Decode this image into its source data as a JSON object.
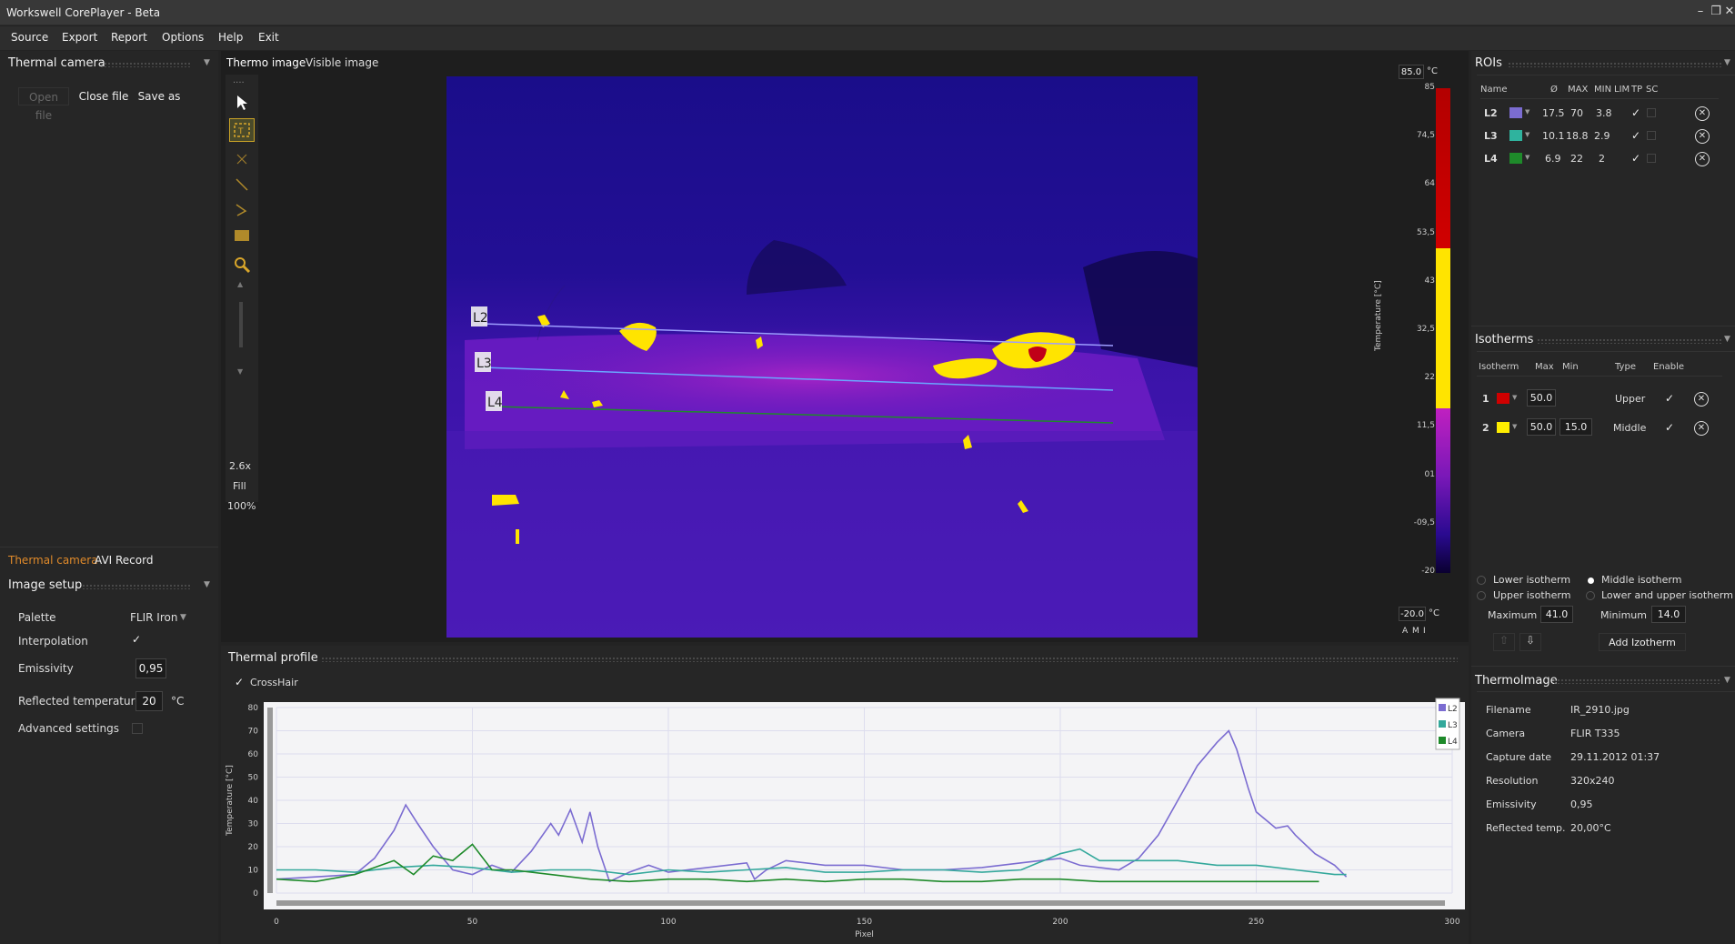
{
  "app": {
    "title": "Workswell CorePlayer - Beta"
  },
  "menu": [
    "Source",
    "Export",
    "Report",
    "Options",
    "Help",
    "Exit"
  ],
  "left": {
    "camera_title": "Thermal camera",
    "open_file": "Open file",
    "close_file": "Close file",
    "save_as": "Save as",
    "tabs": {
      "active": "Thermal camera",
      "other": "AVI Record"
    },
    "image_setup": {
      "title": "Image setup",
      "palette_label": "Palette",
      "palette_value": "FLIR Iron",
      "interpolation_label": "Interpolation",
      "interpolation_checked": true,
      "emissivity_label": "Emissivity",
      "emissivity_value": "0,95",
      "reflected_label": "Reflected temperature",
      "reflected_value": "20",
      "reflected_unit": "°C",
      "advanced_label": "Advanced settings"
    }
  },
  "center": {
    "tabs": {
      "active": "Thermo image",
      "other": "Visible image"
    },
    "tools": {
      "zoom": "2.6x",
      "fill": "Fill",
      "percent": "100%"
    },
    "overlay": {
      "l2": "L2",
      "l3": "L3",
      "l4": "L4"
    },
    "scale": {
      "max": "85.0",
      "min": "-20.0",
      "unit": "°C",
      "axis_label": "Temperature [°C]",
      "ticks": [
        "85",
        "74,5",
        "64",
        "53,5",
        "43",
        "32,5",
        "22",
        "11,5",
        "01",
        "-09,5",
        "-20"
      ],
      "modes": [
        "A",
        "M",
        "I"
      ]
    }
  },
  "profile": {
    "title": "Thermal profile",
    "crosshair_label": "CrossHair",
    "crosshair_checked": true
  },
  "chart_data": {
    "type": "line",
    "xlabel": "Pixel",
    "ylabel": "Temperature [°C]",
    "xlim": [
      0,
      300
    ],
    "ylim": [
      0,
      80
    ],
    "xticks": [
      "0",
      "50",
      "100",
      "150",
      "200",
      "250",
      "300"
    ],
    "yticks": [
      "0",
      "10",
      "20",
      "30",
      "40",
      "50",
      "60",
      "70",
      "80"
    ],
    "grid": true,
    "legend": "top-right",
    "series": [
      {
        "name": "L2",
        "color": "#7b6cd1",
        "x": [
          0,
          10,
          20,
          25,
          30,
          33,
          36,
          40,
          45,
          50,
          55,
          60,
          65,
          70,
          72,
          75,
          78,
          80,
          82,
          85,
          90,
          95,
          100,
          110,
          120,
          122,
          125,
          130,
          140,
          150,
          160,
          170,
          180,
          190,
          200,
          205,
          210,
          215,
          220,
          225,
          230,
          235,
          240,
          243,
          245,
          248,
          250,
          255,
          258,
          260,
          265,
          270,
          273
        ],
        "y": [
          6,
          7,
          8,
          15,
          27,
          38,
          30,
          20,
          10,
          8,
          12,
          9,
          18,
          30,
          25,
          36,
          22,
          35,
          20,
          5,
          9,
          12,
          9,
          11,
          13,
          6,
          10,
          14,
          12,
          12,
          10,
          10,
          11,
          13,
          15,
          12,
          11,
          10,
          15,
          25,
          40,
          55,
          65,
          70,
          62,
          45,
          35,
          28,
          29,
          25,
          17,
          12,
          7
        ]
      },
      {
        "name": "L3",
        "color": "#33a89b",
        "x": [
          0,
          10,
          20,
          30,
          40,
          50,
          60,
          70,
          80,
          90,
          100,
          110,
          120,
          130,
          140,
          150,
          160,
          170,
          180,
          190,
          200,
          205,
          210,
          220,
          230,
          240,
          250,
          260,
          270,
          273
        ],
        "y": [
          10,
          10,
          9,
          11,
          12,
          11,
          9,
          10,
          10,
          8,
          10,
          9,
          10,
          11,
          9,
          9,
          10,
          10,
          9,
          10,
          17,
          19,
          14,
          14,
          14,
          12,
          12,
          10,
          8,
          8
        ]
      },
      {
        "name": "L4",
        "color": "#1e8a2a",
        "x": [
          0,
          10,
          20,
          30,
          35,
          40,
          45,
          50,
          55,
          60,
          70,
          80,
          90,
          100,
          110,
          120,
          130,
          140,
          150,
          160,
          170,
          180,
          190,
          200,
          210,
          220,
          230,
          240,
          250,
          260,
          266
        ],
        "y": [
          6,
          5,
          8,
          14,
          8,
          16,
          14,
          21,
          10,
          10,
          8,
          6,
          5,
          6,
          6,
          5,
          6,
          5,
          6,
          6,
          5,
          5,
          6,
          6,
          5,
          5,
          5,
          5,
          5,
          5,
          5
        ]
      }
    ]
  },
  "rois": {
    "title": "ROIs",
    "headers": [
      "Name",
      "Ø",
      "MAX",
      "MIN",
      "LIM",
      "TP",
      "SC"
    ],
    "rows": [
      {
        "name": "L2",
        "color": "#7b6cd1",
        "avg": "17.5",
        "max": "70",
        "min": "3.8"
      },
      {
        "name": "L3",
        "color": "#2fb39e",
        "avg": "10.1",
        "max": "18.8",
        "min": "2.9"
      },
      {
        "name": "L4",
        "color": "#1e8a2a",
        "avg": "6.9",
        "max": "22",
        "min": "2"
      }
    ]
  },
  "isotherms": {
    "title": "Isotherms",
    "headers": [
      "Isotherm",
      "Max",
      "Min",
      "Type",
      "Enable"
    ],
    "rows": [
      {
        "num": "1",
        "color": "#d00000",
        "max": "50.0",
        "min": "",
        "type": "Upper"
      },
      {
        "num": "2",
        "color": "#ffee00",
        "max": "50.0",
        "min": "15.0",
        "type": "Middle"
      }
    ],
    "radios": [
      "Lower isotherm",
      "Middle isotherm",
      "Upper isotherm",
      "Lower and upper isotherm"
    ],
    "selected": "Middle isotherm",
    "maximum_label": "Maximum",
    "maximum_value": "41.0",
    "minimum_label": "Minimum",
    "minimum_value": "14.0",
    "add_label": "Add Izotherm"
  },
  "thermo": {
    "title": "ThermoImage",
    "rows": [
      {
        "k": "Filename",
        "v": "IR_2910.jpg"
      },
      {
        "k": "Camera",
        "v": "FLIR T335"
      },
      {
        "k": "Capture date",
        "v": "29.11.2012 01:37"
      },
      {
        "k": "Resolution",
        "v": "320x240"
      },
      {
        "k": "Emissivity",
        "v": "0,95"
      },
      {
        "k": "Reflected temp.",
        "v": "20,00°C"
      }
    ]
  }
}
